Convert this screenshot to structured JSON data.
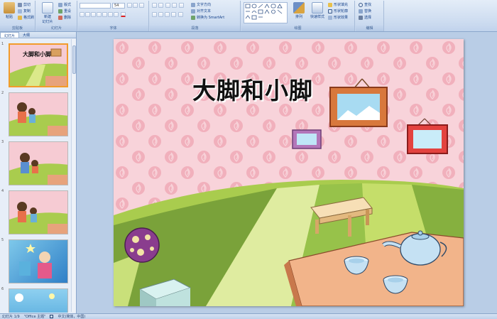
{
  "ribbon": {
    "clipboard": {
      "paste": "粘贴",
      "cut": "剪切",
      "copy": "复制",
      "format_painter": "格式刷",
      "label": "剪贴板"
    },
    "slides": {
      "new_slide": "新建\n幻灯片",
      "layout": "版式",
      "reset": "重设",
      "delete": "删除",
      "label": "幻灯片"
    },
    "font": {
      "font_name": "",
      "font_size": "54",
      "label": "字体"
    },
    "paragraph": {
      "text_direction": "文字方向",
      "align_text": "对齐文本",
      "smartart": "转换为 SmartArt",
      "label": "段落"
    },
    "drawing": {
      "arrange": "排列",
      "quick_styles": "快速样式",
      "shape_fill": "形状填充",
      "shape_outline": "形状轮廓",
      "shape_effects": "形状效果",
      "label": "绘图"
    },
    "editing": {
      "find": "查找",
      "replace": "替换",
      "select": "选择",
      "label": "编辑"
    }
  },
  "panel": {
    "tab_slides": "幻灯片",
    "tab_outline": "大纲"
  },
  "thumbnails": [
    {
      "num": "1",
      "title": "大脚和小脚"
    },
    {
      "num": "2"
    },
    {
      "num": "3"
    },
    {
      "num": "4"
    },
    {
      "num": "5"
    },
    {
      "num": "6"
    }
  ],
  "slide": {
    "title": "大脚和小脚"
  },
  "status": {
    "slide_info": "幻灯片 1/9",
    "theme": "\"Office 主题\"",
    "language": "中文(简体，中国)"
  },
  "colors": {
    "ribbon": "#dbe6f4",
    "selected_thumb": "#f29b2b",
    "slide_pink": "#f5c6cf",
    "grass": "#a9cc4e"
  }
}
